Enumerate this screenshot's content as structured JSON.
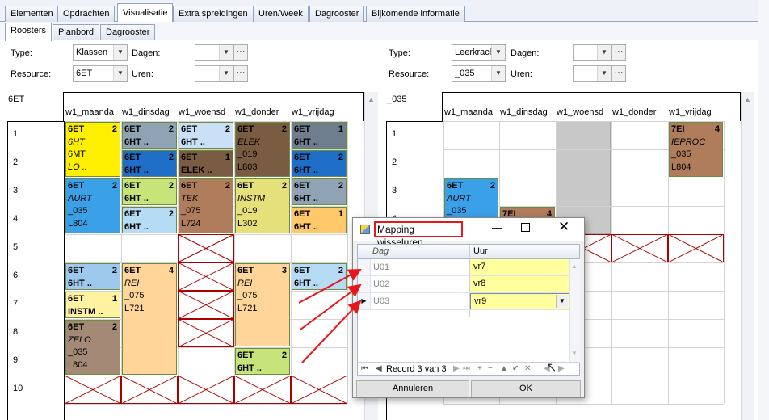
{
  "tabs": [
    "Elementen",
    "Opdrachten",
    "Visualisatie",
    "Extra spreidingen",
    "Uren/Week",
    "Dagrooster",
    "Bijkomende informatie"
  ],
  "subtabs": [
    "Roosters",
    "Planbord",
    "Dagrooster"
  ],
  "left": {
    "type_label": "Type:",
    "type_value": "Klassen",
    "dagen_label": "Dagen:",
    "resource_label": "Resource:",
    "resource_value": "6ET",
    "uren_label": "Uren:",
    "corner": "6ET"
  },
  "right": {
    "type_label": "Type:",
    "type_value": "Leerkracl",
    "dagen_label": "Dagen:",
    "resource_label": "Resource:",
    "resource_value": "_035",
    "uren_label": "Uren:",
    "corner": "_035"
  },
  "ellipsis": "···",
  "days": [
    "w1_maanda",
    "w1_dinsdag",
    "w1_woensd",
    "w1_donder",
    "w1_vrijdag"
  ],
  "hours": [
    "1",
    "2",
    "3",
    "4",
    "5",
    "6",
    "7",
    "8",
    "9",
    "10"
  ],
  "left_cards": [
    {
      "l1": "6ET",
      "n": "2",
      "l2": "6HT",
      "l3": "6MT",
      "l4": "LO ..",
      "i4": true
    },
    {
      "l1": "6ET",
      "n": "2",
      "l2": "6HT .."
    },
    {
      "l1": "6ET",
      "n": "2",
      "l2": "6HT .."
    },
    {
      "l1": "6ET",
      "n": "2",
      "l2": "ELEK",
      "l3": "_019",
      "l4": "L803"
    },
    {
      "l1": "6ET",
      "n": "1",
      "l2": "6HT .."
    },
    {
      "l1": "6ET",
      "n": "2",
      "l2": "6HT .."
    },
    {
      "l1": "6ET",
      "n": "1",
      "l2": "ELEK .."
    },
    {
      "l1": "6ET",
      "n": "2",
      "l2": "6HT .."
    },
    {
      "l1": "6ET",
      "n": "2",
      "l2": "AURT",
      "l3": "_035",
      "l4": "L804"
    },
    {
      "l1": "6ET",
      "n": "2",
      "l2": "6HT .."
    },
    {
      "l1": "6ET",
      "n": "2",
      "l2": "TEK",
      "l3": "_075",
      "l4": "L724"
    },
    {
      "l1": "6ET",
      "n": "2",
      "l2": "INSTM",
      "l3": "_019",
      "l4": "L302"
    },
    {
      "l1": "6ET",
      "n": "2",
      "l2": "6HT .."
    },
    {
      "l1": "6ET",
      "n": "2",
      "l2": "6HT .."
    },
    {
      "l1": "6ET",
      "n": "1",
      "l2": "6HT .."
    },
    {
      "l1": "6ET",
      "n": "2",
      "l2": "6HT .."
    },
    {
      "l1": "6ET",
      "n": "4",
      "l2": "REI",
      "l3": "_075",
      "l4": "L721"
    },
    {
      "l1": "6ET",
      "n": "3",
      "l2": "REI",
      "l3": "_075",
      "l4": "L721"
    },
    {
      "l1": "6ET",
      "n": "2",
      "l2": "6HT .."
    },
    {
      "l1": "6ET",
      "n": "1",
      "l2": "INSTM .."
    },
    {
      "l1": "6ET",
      "n": "2",
      "l2": "ZELO",
      "l3": "_035",
      "l4": "L804"
    },
    {
      "l1": "6ET",
      "n": "2",
      "l2": "6HT .."
    }
  ],
  "right_cards": [
    {
      "l1": "7EI",
      "n": "4",
      "l2": "IEPROC",
      "l3": "_035",
      "l4": "L804"
    },
    {
      "l1": "6ET",
      "n": "2",
      "l2": "AURT",
      "l3": "_035"
    },
    {
      "l1": "7EI",
      "n": "4"
    }
  ],
  "dialog": {
    "title": "Mapping wisseluren",
    "col_dag": "Dag",
    "col_uur": "Uur",
    "rows": [
      {
        "dag": "U01",
        "uur": "vr7"
      },
      {
        "dag": "U02",
        "uur": "vr8"
      },
      {
        "dag": "U03",
        "uur": "vr9"
      }
    ],
    "record": "Record 3 van 3",
    "cancel": "Annuleren",
    "ok": "OK"
  },
  "colors": {
    "accent": "#e8161b",
    "yellow": "#ffef00",
    "blue": "#1f6fc9",
    "selected": "#ffff9e"
  }
}
